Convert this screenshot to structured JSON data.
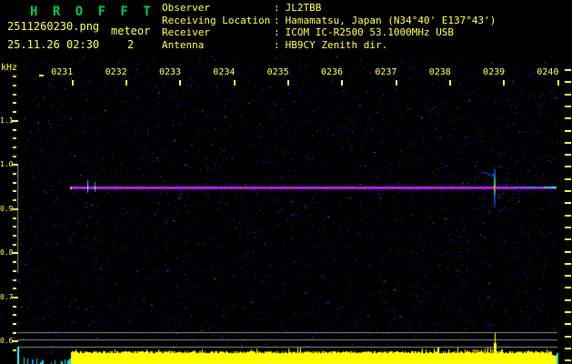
{
  "header": {
    "title": "H R O F F T",
    "filename": "2511260230.png",
    "mode": "meteor",
    "datetime": "25.11.26 02:30",
    "count": "2",
    "colon": ":",
    "info": [
      {
        "label": "Observer",
        "value": "JL2TBB"
      },
      {
        "label": "Receiving Location",
        "value": "Hamamatsu, Japan (N34°40' E137°43')"
      },
      {
        "label": "Receiver",
        "value": "ICOM IC-R2500 53.1000MHz USB"
      },
      {
        "label": "Antenna",
        "value": "HB9CY Zenith dir."
      }
    ]
  },
  "axes": {
    "y_unit": "kHz",
    "time_labels": [
      "0231",
      "0232",
      "0233",
      "0234",
      "0235",
      "0236",
      "0237",
      "0238",
      "0239",
      "0240"
    ],
    "freq_labels": [
      "1.1",
      "1.0",
      "0.9",
      "0.8",
      "0.7",
      "0.6"
    ]
  },
  "chart_data": {
    "type": "heatmap",
    "title": "HROFFT 10-minute radio meteor observation spectrogram",
    "x": {
      "start": "02:30",
      "end": "02:40",
      "tick_labels": [
        "0231",
        "0232",
        "0233",
        "0234",
        "0235",
        "0236",
        "0237",
        "0238",
        "0239",
        "0240"
      ],
      "seconds_per_pixel": 1
    },
    "y": {
      "label": "kHz",
      "ticks": [
        1.1,
        1.0,
        0.9,
        0.8,
        0.7,
        0.6
      ],
      "minor_step_khz": 0.02
    },
    "carrier_line": {
      "freq_khz": 0.95,
      "from": "02:31:00",
      "to": "02:40:00",
      "color": "#e833ff"
    },
    "events": [
      {
        "time": "02:31:18",
        "type": "blip",
        "freq_span_khz": [
          0.937,
          0.966
        ],
        "color": "#35c8f2"
      },
      {
        "time": "02:31:26",
        "type": "blip",
        "freq_span_khz": [
          0.94,
          0.962
        ],
        "color": "#2fb84d"
      },
      {
        "time": "02:38:51",
        "type": "meteor-echo",
        "freq_span_khz": [
          0.903,
          0.99
        ],
        "color": "#ff3326"
      }
    ],
    "left_scale_bar": {
      "freq_span_khz": [
        0.755,
        1.0
      ],
      "color": "#8a8a8a"
    },
    "level_panel": {
      "bar_color": "#ffff00",
      "active_from": "02:31:00",
      "spike_time": "02:38:51",
      "idle_bar_color": "#00dede",
      "reference_line_color": "#8a8a8a"
    },
    "noise_floor_colors": [
      "#000850",
      "#0012a0",
      "#2030b8",
      "#3848d8",
      "#0a9ab0"
    ]
  },
  "colors": {
    "background": "#000000",
    "text_yellow": "#ffff44",
    "title_green": "#00cc44",
    "grid_gray": "#8a8a8a",
    "carrier_magenta": "#e833ff",
    "level_yellow": "#ffff00"
  }
}
